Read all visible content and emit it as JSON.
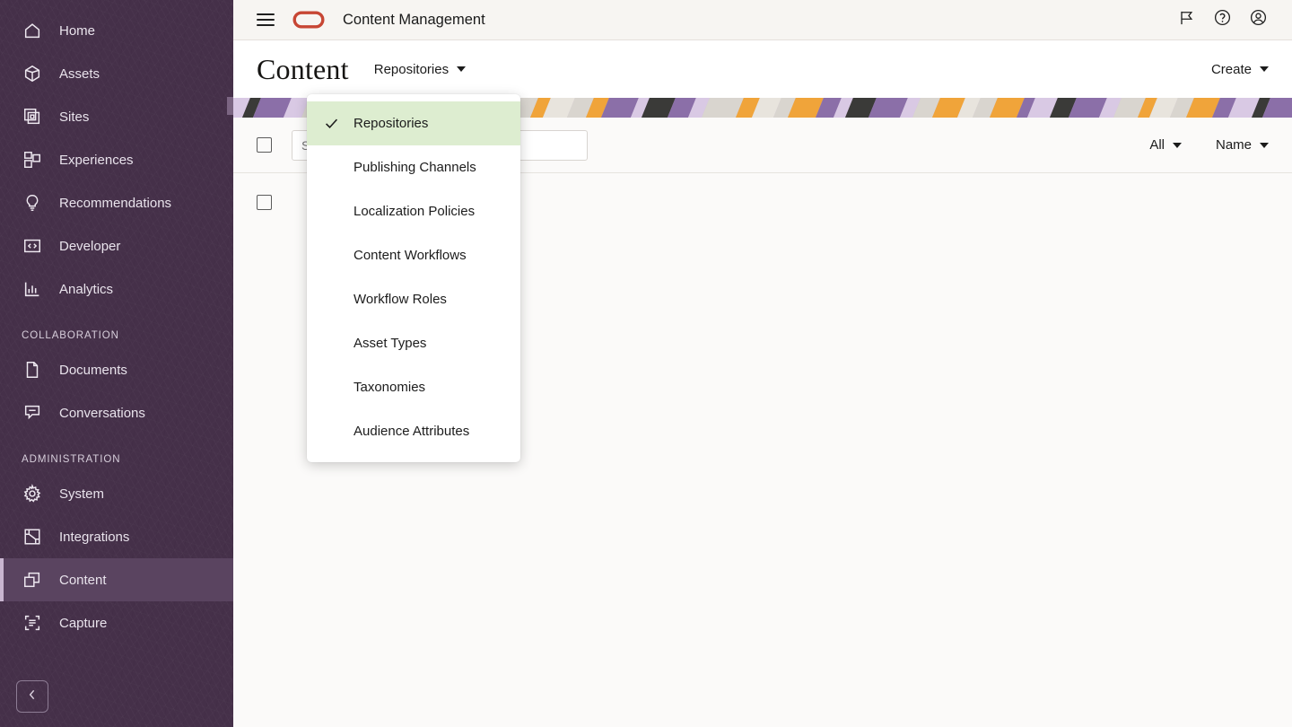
{
  "theme": {
    "sidebar_bg": "#453049",
    "sidebar_active_bg": "#5a4460",
    "accent_red": "#c74634",
    "menu_selected_bg": "#ddedd0",
    "page_bg": "#fbfaf9",
    "topbar_bg": "#f7f5f2"
  },
  "sidebar": {
    "items": [
      {
        "label": "Home",
        "icon": "home-icon",
        "active": false
      },
      {
        "label": "Assets",
        "icon": "assets-cube-icon",
        "active": false
      },
      {
        "label": "Sites",
        "icon": "sites-pages-icon",
        "active": false
      },
      {
        "label": "Experiences",
        "icon": "experiences-blocks-icon",
        "active": false
      },
      {
        "label": "Recommendations",
        "icon": "lightbulb-icon",
        "active": false
      },
      {
        "label": "Developer",
        "icon": "code-brackets-icon",
        "active": false
      },
      {
        "label": "Analytics",
        "icon": "bar-chart-icon",
        "active": false
      }
    ],
    "sections": [
      {
        "label": "COLLABORATION",
        "items": [
          {
            "label": "Documents",
            "icon": "documents-icon",
            "active": false
          },
          {
            "label": "Conversations",
            "icon": "conversations-icon",
            "active": false
          }
        ]
      },
      {
        "label": "ADMINISTRATION",
        "items": [
          {
            "label": "System",
            "icon": "gear-icon",
            "active": false
          },
          {
            "label": "Integrations",
            "icon": "integrations-puzzle-icon",
            "active": false
          },
          {
            "label": "Content",
            "icon": "content-layers-icon",
            "active": true
          },
          {
            "label": "Capture",
            "icon": "capture-scan-icon",
            "active": false
          }
        ]
      }
    ],
    "collapse_button": {
      "icon": "chevron-left-icon",
      "label": "Collapse navigation"
    }
  },
  "topbar": {
    "menu_icon": "hamburger-icon",
    "logo": "oracle-logo",
    "title": "Content Management",
    "icons": [
      {
        "name": "flag-icon",
        "label": "Announcements"
      },
      {
        "name": "help-circle-icon",
        "label": "Help"
      },
      {
        "name": "user-account-icon",
        "label": "User Account"
      }
    ]
  },
  "page": {
    "title": "Content",
    "nav_dropdown_label": "Repositories",
    "create_button_label": "Create"
  },
  "toolbar": {
    "select_all_checkbox": false,
    "search_placeholder": "Search",
    "search_value": "",
    "filter_dropdown_label": "All",
    "sort_dropdown_label": "Name"
  },
  "list": {
    "rows": [
      {
        "checked": false
      }
    ]
  },
  "dropdown_menu": {
    "open": true,
    "items": [
      {
        "label": "Repositories",
        "selected": true
      },
      {
        "label": "Publishing Channels",
        "selected": false
      },
      {
        "label": "Localization Policies",
        "selected": false
      },
      {
        "label": "Content Workflows",
        "selected": false
      },
      {
        "label": "Workflow Roles",
        "selected": false
      },
      {
        "label": "Asset Types",
        "selected": false
      },
      {
        "label": "Taxonomies",
        "selected": false
      },
      {
        "label": "Audience Attributes",
        "selected": false
      }
    ]
  },
  "banner": {
    "name": "decorative-stripe-banner",
    "colors": [
      "#8b6fa8",
      "#f0a43a",
      "#3a3a38",
      "#d9d5cf",
      "#d9c9e4",
      "#e8e4dd"
    ]
  }
}
